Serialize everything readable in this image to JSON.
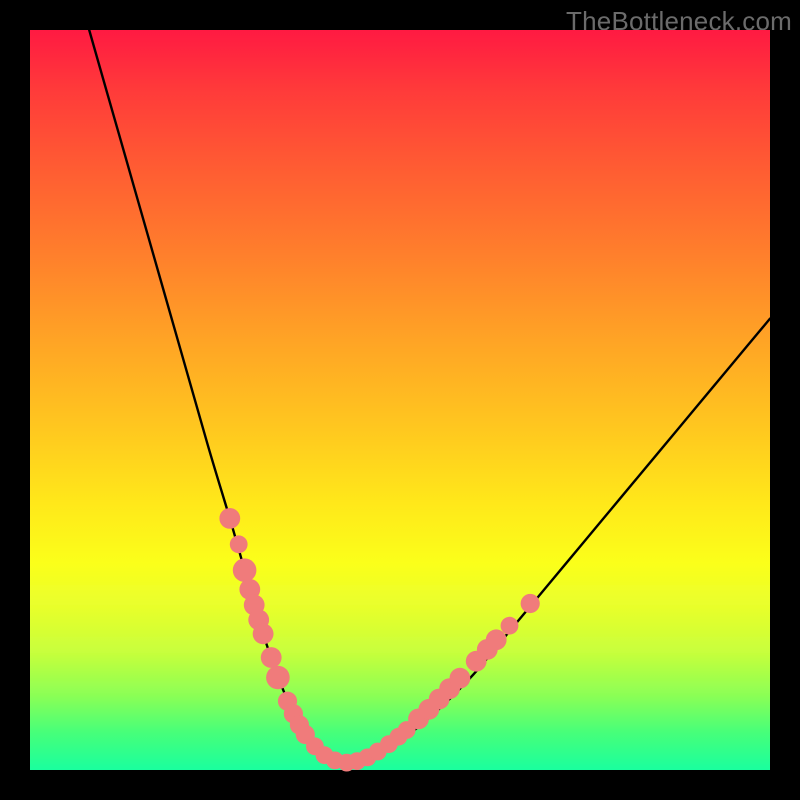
{
  "watermark": "TheBottleneck.com",
  "colors": {
    "dot": "#f07b7b",
    "curve": "#000000",
    "frame_bg": "#000000"
  },
  "chart_data": {
    "type": "line",
    "title": "",
    "xlabel": "",
    "ylabel": "",
    "xlim": [
      0,
      100
    ],
    "ylim": [
      0,
      100
    ],
    "grid": false,
    "legend": false,
    "series": [
      {
        "name": "bottleneck-curve",
        "x": [
          8,
          12,
          16,
          20,
          24,
          27,
          29,
          31,
          33,
          35,
          37,
          39,
          41,
          43,
          45,
          50,
          55,
          60,
          65,
          70,
          75,
          80,
          85,
          90,
          95,
          100
        ],
        "y": [
          100,
          86,
          72,
          58,
          44,
          34,
          27,
          20,
          14,
          9,
          5.5,
          3,
          1.5,
          1,
          1.5,
          4,
          8,
          13,
          19,
          25,
          31,
          37,
          43,
          49,
          55,
          61
        ]
      }
    ],
    "markers": [
      {
        "x": 27.0,
        "y": 34.0,
        "r": 1.4
      },
      {
        "x": 28.2,
        "y": 30.5,
        "r": 1.2
      },
      {
        "x": 29.0,
        "y": 27.0,
        "r": 1.6
      },
      {
        "x": 29.7,
        "y": 24.4,
        "r": 1.4
      },
      {
        "x": 30.3,
        "y": 22.3,
        "r": 1.4
      },
      {
        "x": 30.9,
        "y": 20.3,
        "r": 1.4
      },
      {
        "x": 31.5,
        "y": 18.4,
        "r": 1.4
      },
      {
        "x": 32.6,
        "y": 15.2,
        "r": 1.4
      },
      {
        "x": 33.5,
        "y": 12.5,
        "r": 1.6
      },
      {
        "x": 34.8,
        "y": 9.3,
        "r": 1.3
      },
      {
        "x": 35.6,
        "y": 7.6,
        "r": 1.3
      },
      {
        "x": 36.4,
        "y": 6.1,
        "r": 1.3
      },
      {
        "x": 37.2,
        "y": 4.8,
        "r": 1.3
      },
      {
        "x": 38.5,
        "y": 3.2,
        "r": 1.2
      },
      {
        "x": 39.8,
        "y": 2.0,
        "r": 1.2
      },
      {
        "x": 41.2,
        "y": 1.3,
        "r": 1.2
      },
      {
        "x": 42.8,
        "y": 1.0,
        "r": 1.2
      },
      {
        "x": 44.2,
        "y": 1.2,
        "r": 1.2
      },
      {
        "x": 45.6,
        "y": 1.7,
        "r": 1.2
      },
      {
        "x": 47.0,
        "y": 2.5,
        "r": 1.2
      },
      {
        "x": 48.5,
        "y": 3.5,
        "r": 1.2
      },
      {
        "x": 49.8,
        "y": 4.5,
        "r": 1.2
      },
      {
        "x": 50.9,
        "y": 5.4,
        "r": 1.2
      },
      {
        "x": 52.5,
        "y": 6.9,
        "r": 1.4
      },
      {
        "x": 53.9,
        "y": 8.2,
        "r": 1.4
      },
      {
        "x": 55.3,
        "y": 9.6,
        "r": 1.4
      },
      {
        "x": 56.7,
        "y": 11.0,
        "r": 1.4
      },
      {
        "x": 58.1,
        "y": 12.4,
        "r": 1.4
      },
      {
        "x": 60.3,
        "y": 14.7,
        "r": 1.4
      },
      {
        "x": 61.8,
        "y": 16.3,
        "r": 1.4
      },
      {
        "x": 63.0,
        "y": 17.6,
        "r": 1.4
      },
      {
        "x": 64.8,
        "y": 19.5,
        "r": 1.2
      },
      {
        "x": 67.6,
        "y": 22.5,
        "r": 1.3
      }
    ],
    "light_bands_y": [
      25,
      18,
      12
    ]
  }
}
